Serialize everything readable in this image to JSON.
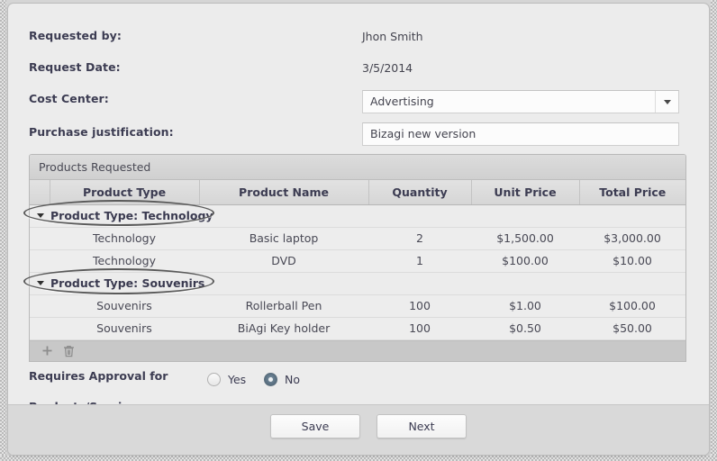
{
  "form": {
    "fields": [
      {
        "label": "Requested by:",
        "value": "Jhon Smith",
        "type": "text"
      },
      {
        "label": "Request Date:",
        "value": "3/5/2014",
        "type": "text"
      },
      {
        "label": "Cost Center:",
        "value": "Advertising",
        "type": "select"
      },
      {
        "label": "Purchase justification:",
        "value": "Bizagi new version",
        "type": "input"
      }
    ]
  },
  "grid": {
    "title": "Products Requested",
    "columns": [
      "Product Type",
      "Product Name",
      "Quantity",
      "Unit Price",
      "Total Price"
    ],
    "groups": [
      {
        "header": "Product Type: Technology",
        "rows": [
          {
            "product_type": "Technology",
            "product_name": "Basic laptop",
            "quantity": "2",
            "unit_price": "$1,500.00",
            "total_price": "$3,000.00"
          },
          {
            "product_type": "Technology",
            "product_name": "DVD",
            "quantity": "1",
            "unit_price": "$100.00",
            "total_price": "$10.00"
          }
        ]
      },
      {
        "header": "Product Type: Souvenirs",
        "rows": [
          {
            "product_type": "Souvenirs",
            "product_name": "Rollerball Pen",
            "quantity": "100",
            "unit_price": "$1.00",
            "total_price": "$100.00"
          },
          {
            "product_type": "Souvenirs",
            "product_name": "BiAgi Key holder",
            "quantity": "100",
            "unit_price": "$0.50",
            "total_price": "$50.00"
          }
        ]
      }
    ],
    "toolbar": {
      "add_label": "+",
      "delete_label": "Ὕ1"
    }
  },
  "approval": {
    "label_line1": "Requires Approval for",
    "label_line2": "Products/Services:",
    "options": [
      {
        "text": "Yes",
        "checked": false
      },
      {
        "text": "No",
        "checked": true
      }
    ]
  },
  "footer": {
    "save_label": "Save",
    "next_label": "Next"
  },
  "colors": {
    "card_background": "#ececec",
    "footer_background": "#d9d9d9",
    "grid_header": "#d6d6d6",
    "grid_toolbar": "#c8c8c8",
    "label_text": "#3c3c52",
    "radio_selected": "#5d7384",
    "annotation_outline": "#5a5a5a"
  }
}
